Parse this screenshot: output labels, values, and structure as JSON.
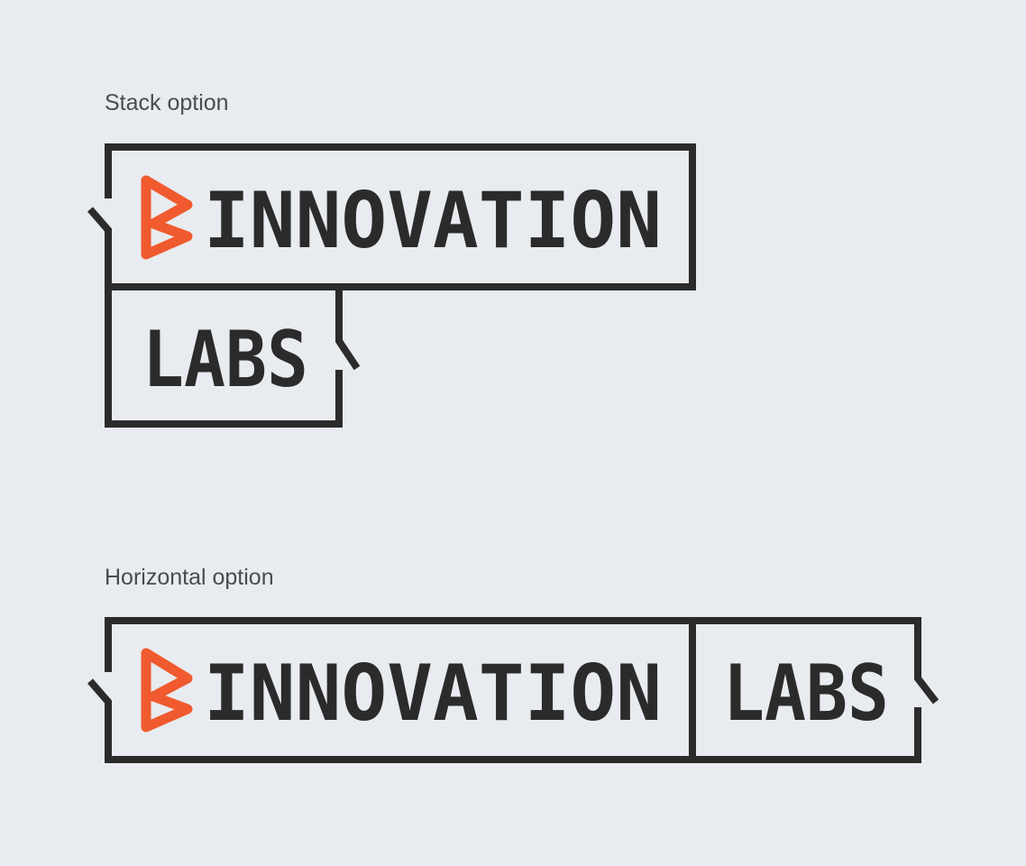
{
  "colors": {
    "background": "#e8ebef",
    "ink": "#2b2b2b",
    "accent": "#f05a2e",
    "caption": "#4a4c4f"
  },
  "stack": {
    "caption": "Stack option",
    "word_top": "INNOVATION",
    "word_bottom": "LABS",
    "mark_icon": "chevron-mark-icon"
  },
  "horizontal": {
    "caption": "Horizontal option",
    "word_left": "INNOVATION",
    "word_right": "LABS",
    "mark_icon": "chevron-mark-icon"
  }
}
